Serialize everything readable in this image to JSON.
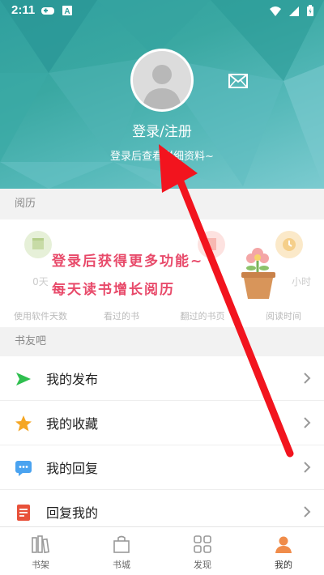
{
  "status": {
    "time": "2:11"
  },
  "profile": {
    "login_title": "登录/注册",
    "login_sub": "登录后查看详细资料~"
  },
  "history": {
    "section_label": "阅历",
    "stats": [
      {
        "value": "0天",
        "label": "使用软件天数",
        "icon": "calendar-icon"
      },
      {
        "value": "",
        "label": "看过的书",
        "icon": "book-icon"
      },
      {
        "value": "",
        "label": "翻过的书页",
        "icon": "page-icon"
      },
      {
        "value": "小时",
        "label": "阅读时间",
        "icon": "clock-icon"
      }
    ],
    "overlay_line1": "登录后获得更多功能~",
    "overlay_line2": "每天读书增长阅历"
  },
  "community": {
    "section_label": "书友吧",
    "items": [
      {
        "label": "我的发布",
        "icon": "send-icon",
        "color": "#2fbf4f"
      },
      {
        "label": "我的收藏",
        "icon": "star-icon",
        "color": "#f5a623"
      },
      {
        "label": "我的回复",
        "icon": "chat-icon",
        "color": "#4aa3f0"
      },
      {
        "label": "回复我的",
        "icon": "document-icon",
        "color": "#e8513a"
      }
    ]
  },
  "nav": {
    "items": [
      {
        "label": "书架",
        "icon": "bookshelf-icon"
      },
      {
        "label": "书城",
        "icon": "bookstore-icon"
      },
      {
        "label": "发现",
        "icon": "discover-icon"
      },
      {
        "label": "我的",
        "icon": "profile-icon"
      }
    ],
    "active_color": "#f08c4a"
  },
  "colors": {
    "arrow": "#f2141e",
    "header": "#3aa8a2"
  }
}
